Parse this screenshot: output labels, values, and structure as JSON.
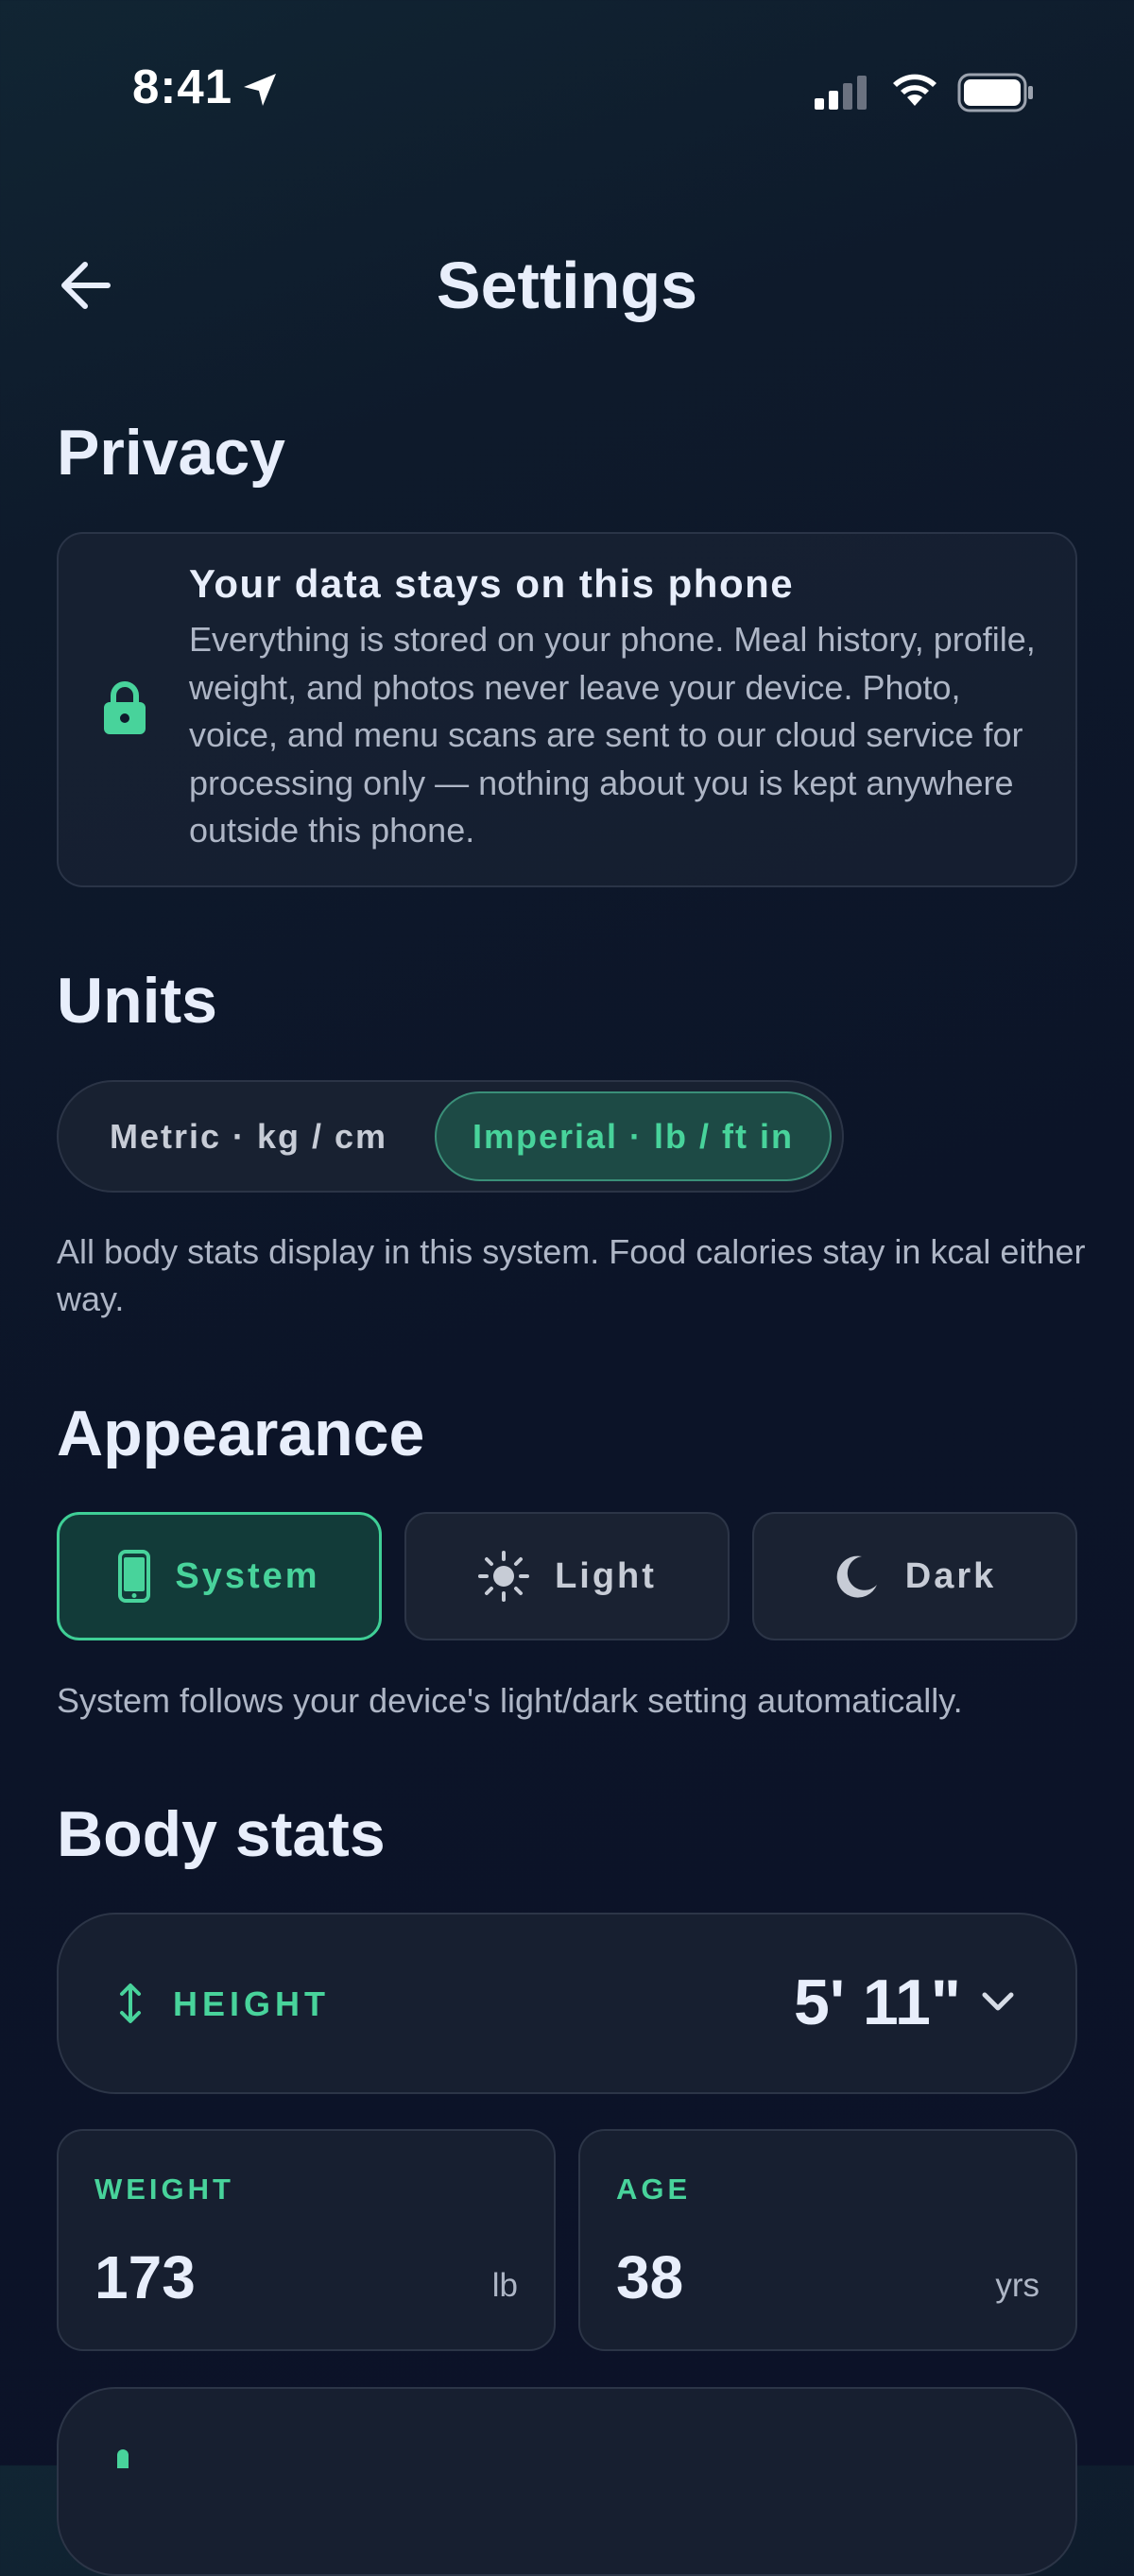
{
  "status_bar": {
    "time": "8:41"
  },
  "header": {
    "title": "Settings"
  },
  "privacy": {
    "heading": "Privacy",
    "card_title": "Your data stays on this phone",
    "card_body": "Everything is stored on your phone. Meal history, profile, weight, and photos never leave your device. Photo, voice, and menu scans are sent to our cloud service for processing only — nothing about you is kept anywhere outside this phone."
  },
  "units": {
    "heading": "Units",
    "options": [
      "Metric · kg / cm",
      "Imperial · lb / ft in"
    ],
    "selected": "Imperial · lb / ft in",
    "helper": "All body stats display in this system. Food calories stay in kcal either way."
  },
  "appearance": {
    "heading": "Appearance",
    "options": [
      {
        "label": "System",
        "icon": "phone-icon"
      },
      {
        "label": "Light",
        "icon": "sun-icon"
      },
      {
        "label": "Dark",
        "icon": "moon-icon"
      }
    ],
    "selected": "System",
    "helper": "System follows your device's light/dark setting automatically."
  },
  "body_stats": {
    "heading": "Body stats",
    "height": {
      "label": "HEIGHT",
      "value": "5' 11\""
    },
    "weight": {
      "label": "WEIGHT",
      "value": "173",
      "unit": "lb"
    },
    "age": {
      "label": "AGE",
      "value": "38",
      "unit": "yrs"
    }
  },
  "colors": {
    "accent": "#48d39b",
    "background": "#0c1428",
    "card": "#171f30"
  }
}
